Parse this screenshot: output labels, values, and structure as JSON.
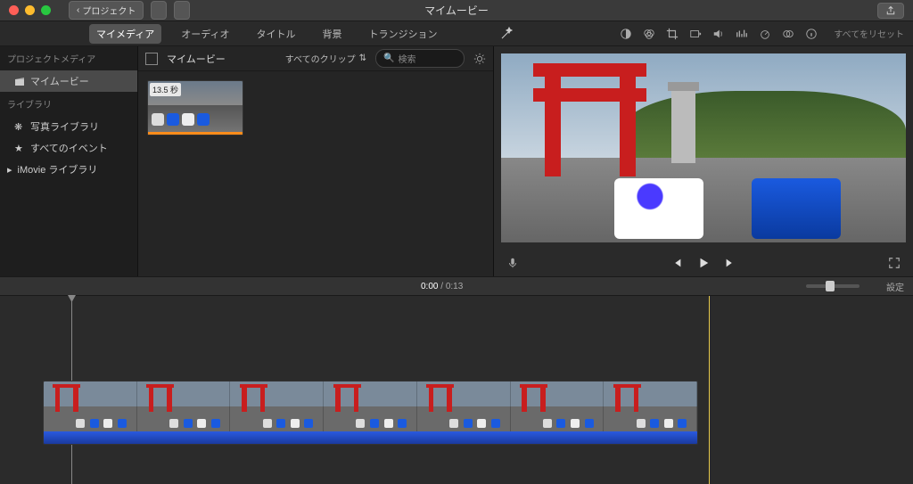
{
  "titlebar": {
    "back_label": "プロジェクト",
    "title": "マイムービー"
  },
  "tabs": {
    "my_media": "マイメディア",
    "audio": "オーディオ",
    "titles": "タイトル",
    "backgrounds": "背景",
    "transitions": "トランジション"
  },
  "viewer_toolbar": {
    "reset_all": "すべてをリセット"
  },
  "sidebar": {
    "project_media_header": "プロジェクトメディア",
    "project_item": "マイムービー",
    "library_header": "ライブラリ",
    "photo_library": "写真ライブラリ",
    "all_events": "すべてのイベント",
    "imovie_library": "iMovie ライブラリ"
  },
  "browser": {
    "crumb": "マイムービー",
    "filter_label": "すべてのクリップ",
    "search_placeholder": "検索",
    "clip_duration_badge": "13.5 秒"
  },
  "timeline": {
    "current_time": "0:00",
    "total_time": "0:13",
    "settings_label": "設定"
  }
}
